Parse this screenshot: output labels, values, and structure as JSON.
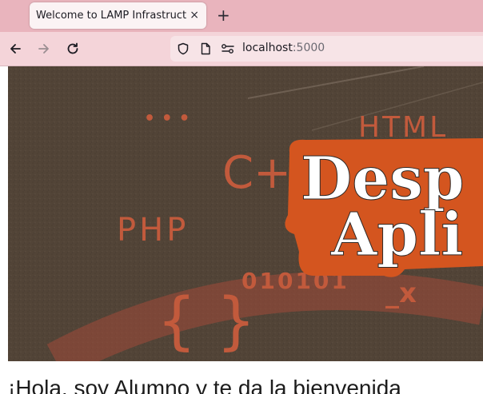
{
  "browser": {
    "tab": {
      "title": "Welcome to LAMP Infrastructure",
      "close_glyph": "×"
    },
    "new_tab_glyph": "+",
    "nav": {
      "back_icon": "arrow-left-icon",
      "forward_icon": "arrow-right-icon",
      "reload_icon": "reload-icon"
    },
    "url": {
      "host": "localhost",
      "port": ":5000"
    }
  },
  "hero": {
    "doodles": {
      "html": "HTML",
      "c_plus": "C+",
      "php": "PHP",
      "binary": "010101",
      "dots": "• • •",
      "braces": "{ }",
      "cursor": "_x"
    },
    "title_line1": "Desp",
    "title_line2": "Apli",
    "colors": {
      "chalkboard": "#524437",
      "accent": "#d4551f",
      "chalk": "#c25a3c"
    }
  },
  "main": {
    "greeting": "¡Hola, soy Alumno y te da la bienvenida"
  }
}
